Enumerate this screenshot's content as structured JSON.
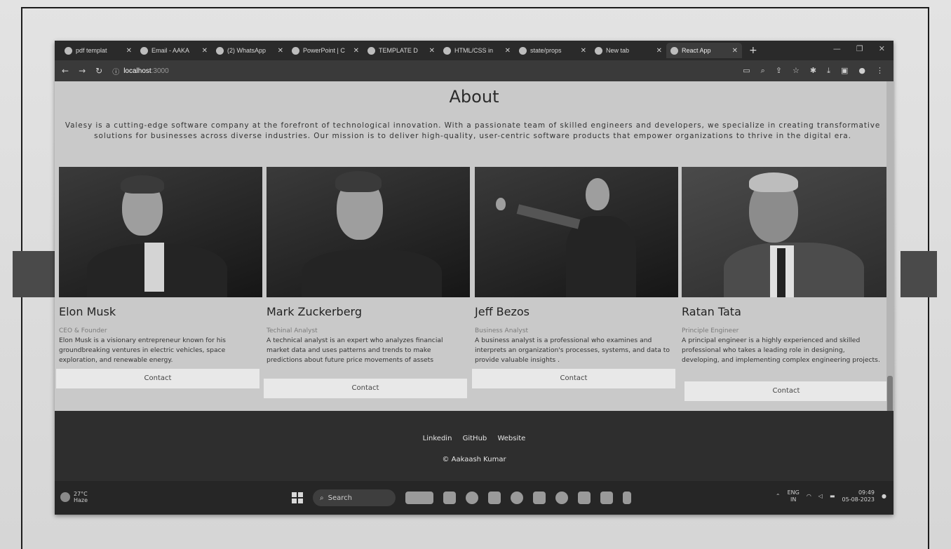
{
  "browser": {
    "tabs": [
      {
        "label": "pdf templat",
        "active": false
      },
      {
        "label": "Email - AAKA",
        "active": false
      },
      {
        "label": "(2) WhatsApp",
        "active": false
      },
      {
        "label": "PowerPoint | C",
        "active": false
      },
      {
        "label": "TEMPLATE D",
        "active": false
      },
      {
        "label": "HTML/CSS in",
        "active": false
      },
      {
        "label": "state/props",
        "active": false
      },
      {
        "label": "New tab",
        "active": false
      },
      {
        "label": "React App",
        "active": true
      }
    ],
    "new_tab_symbol": "+",
    "url_host": "localhost",
    "url_port": ":3000"
  },
  "about": {
    "title": "About",
    "text": "Valesy is a cutting-edge software company at the forefront of technological innovation. With a passionate team of skilled engineers and developers, we specialize in creating transformative solutions for businesses across diverse industries. Our mission is to deliver high-quality, user-centric software products that empower organizations to thrive in the digital era."
  },
  "team": [
    {
      "name": "Elon Musk",
      "role": "CEO & Founder",
      "desc": "Elon Musk is a visionary entrepreneur known for his groundbreaking ventures in electric vehicles, space exploration, and renewable energy.",
      "button": "Contact"
    },
    {
      "name": "Mark Zuckerberg",
      "role": "Techinal Analyst",
      "desc": "A technical analyst is an expert who analyzes financial market data and uses patterns and trends to make predictions about future price movements of assets",
      "button": "Contact"
    },
    {
      "name": "Jeff Bezos",
      "role": "Business Analyst",
      "desc": "A business analyst is a professional who examines and interprets an organization's processes, systems, and data to provide valuable insights .",
      "button": "Contact"
    },
    {
      "name": "Ratan Tata",
      "role": "Principle Engineer",
      "desc": "A principal engineer is a highly experienced and skilled professional who takes a leading role in designing, developing, and implementing complex engineering projects.",
      "button": "Contact"
    }
  ],
  "footer": {
    "links": [
      "Linkedin",
      "GitHub",
      "Website"
    ],
    "copyright": "© Aakaash Kumar"
  },
  "taskbar": {
    "temp": "27°C",
    "weather": "Haze",
    "search": "Search",
    "lang_top": "ENG",
    "lang_bottom": "IN",
    "time": "09:49",
    "date": "05-08-2023"
  }
}
